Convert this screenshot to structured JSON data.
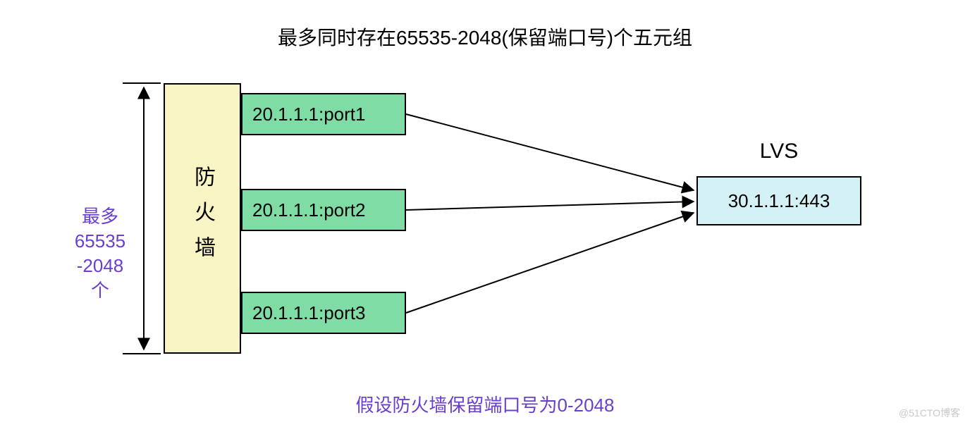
{
  "title": "最多同时存在65535-2048(保留端口号)个五元组",
  "side_label_lines": [
    "最多",
    "65535",
    "-2048",
    "个"
  ],
  "firewall": {
    "label": "防火墙"
  },
  "ports": {
    "p1": "20.1.1.1:port1",
    "p2": "20.1.1.1:port2",
    "p3": "20.1.1.1:port3"
  },
  "lvs": {
    "label": "LVS",
    "value": "30.1.1.1:443"
  },
  "footer_note": "假设防火墙保留端口号为0-2048",
  "watermark": "@51CTO博客"
}
